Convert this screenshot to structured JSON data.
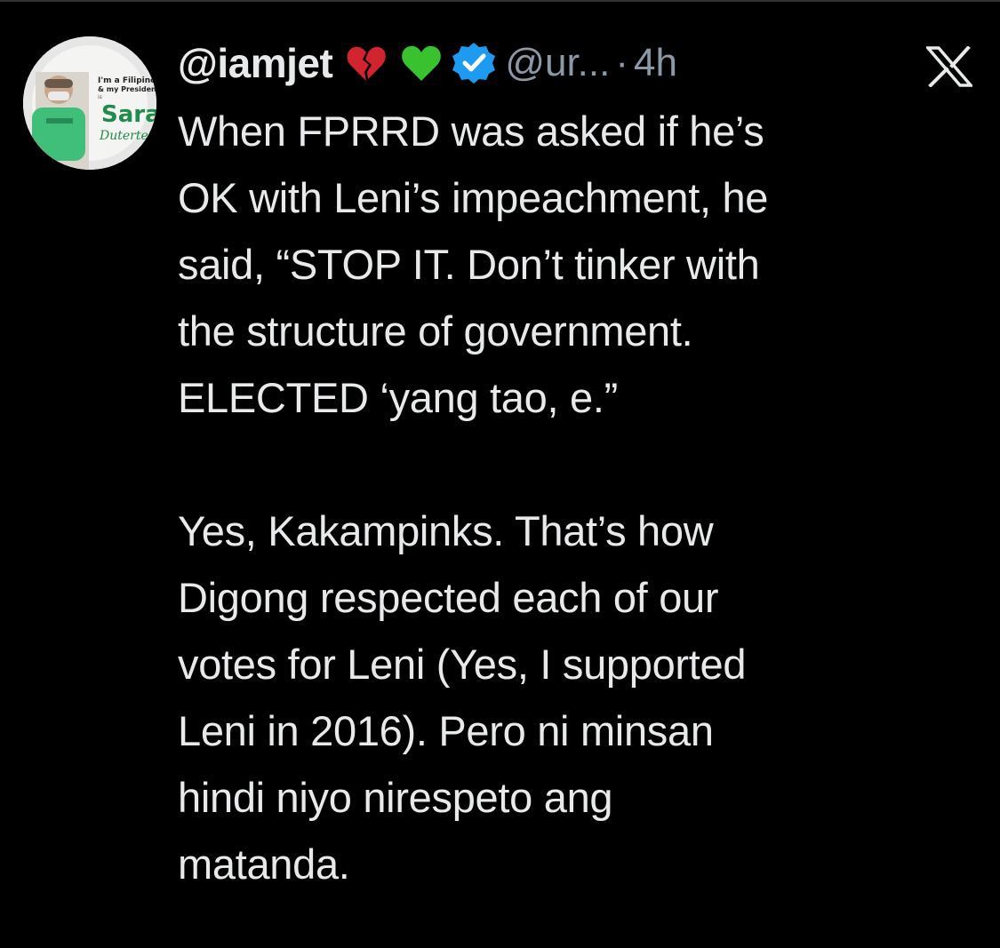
{
  "tweet": {
    "author_handle": "@iamjet",
    "author_emojis": [
      "broken-heart-icon",
      "green-heart-icon"
    ],
    "verified": true,
    "username_truncated": "@ur...",
    "separator": "·",
    "timestamp": "4h",
    "avatar_text": {
      "line1": "I'm a Filipino",
      "line2": "& my President",
      "line3": "is",
      "line4": "Sara",
      "line5": "Duterte"
    },
    "paragraph1": [
      "When FPRRD was asked if he’s",
      "OK with Leni’s impeachment, he",
      "said, “STOP IT. Don’t tinker with",
      "the structure of government.",
      "ELECTED ‘yang tao, e.”"
    ],
    "paragraph2": [
      "Yes, Kakampinks. That’s how",
      "Digong respected each of our",
      "votes for Leni (Yes, I supported",
      "Leni in 2016). Pero ni minsan",
      "hindi niyo nirespeto ang",
      "matanda."
    ]
  },
  "colors": {
    "background": "#000000",
    "text": "#e7e9ea",
    "secondary_text": "#8b98a5",
    "verified_blue": "#1d9bf0",
    "broken_heart_red": "#d1242f",
    "green_heart": "#39c12f"
  },
  "icons": {
    "close": "x-logo-icon"
  }
}
